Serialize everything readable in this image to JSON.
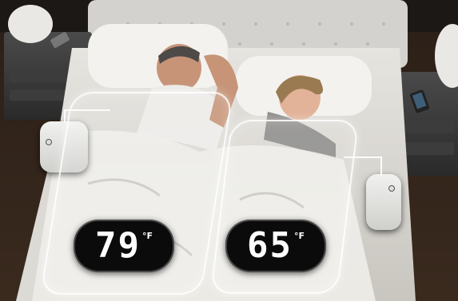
{
  "scene": {
    "left_zone": {
      "temperature": "79",
      "unit": "°F"
    },
    "right_zone": {
      "temperature": "65",
      "unit": "°F"
    }
  },
  "colors": {
    "background": "#141210",
    "display_bg": "#0b0b0b",
    "display_text": "#ffffff",
    "zone_outline": "#ffffff",
    "hub_body": "#e8e8e6"
  },
  "icons": [
    "control-hub-left",
    "control-hub-right",
    "phone",
    "lamp"
  ]
}
